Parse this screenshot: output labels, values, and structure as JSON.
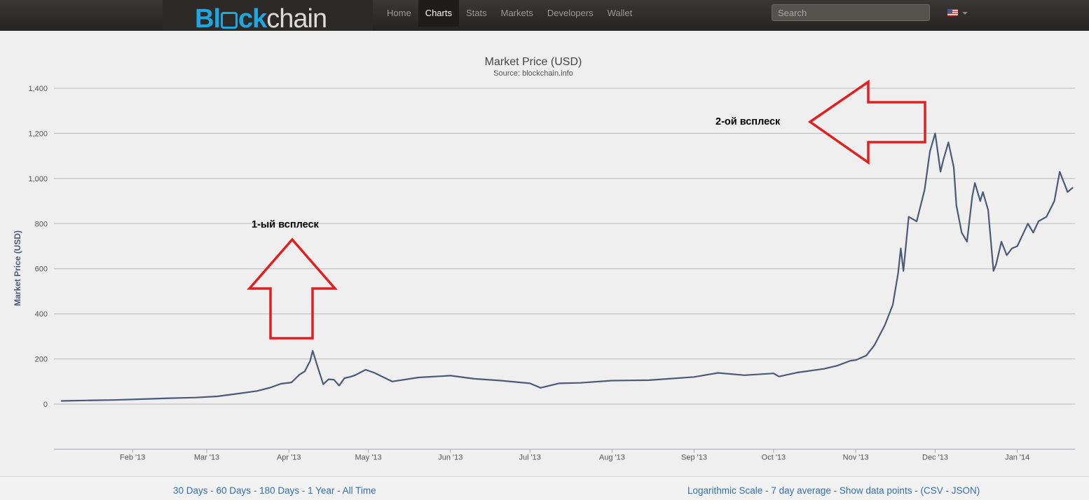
{
  "header": {
    "logo_part1": "Bl",
    "logo_part2": "ck",
    "logo_part3": "chain",
    "nav": [
      "Home",
      "Charts",
      "Stats",
      "Markets",
      "Developers",
      "Wallet"
    ],
    "active_nav": "Charts",
    "search_placeholder": "Search",
    "language_flag": "us-flag-icon"
  },
  "chart_data": {
    "type": "line",
    "title": "Market Price (USD)",
    "subtitle": "Source: blockchain.info",
    "ylabel": "Market Price (USD)",
    "xlabel": "",
    "ylim": [
      -200,
      1400
    ],
    "y_ticks": [
      0,
      200,
      400,
      600,
      800,
      1000,
      1200,
      1400
    ],
    "y_tick_labels": [
      "0",
      "200",
      "400",
      "600",
      "800",
      "1,000",
      "1,200",
      "1,400"
    ],
    "x_tick_labels": [
      "Feb '13",
      "Mar '13",
      "Apr '13",
      "May '13",
      "Jun '13",
      "Jul '13",
      "Aug '13",
      "Sep '13",
      "Oct '13",
      "Nov '13",
      "Dec '13",
      "Jan '14"
    ],
    "x_tick_dates": [
      "2013-02-01",
      "2013-03-01",
      "2013-04-01",
      "2013-05-01",
      "2013-06-01",
      "2013-07-01",
      "2013-08-01",
      "2013-09-01",
      "2013-10-01",
      "2013-11-01",
      "2013-12-01",
      "2014-01-01"
    ],
    "xlim": [
      "2013-01-01",
      "2014-01-24"
    ],
    "grid": true,
    "line_color": "#4a5a78",
    "series": [
      {
        "x": [
          "2013-01-05",
          "2013-01-15",
          "2013-01-25",
          "2013-02-05",
          "2013-02-15",
          "2013-02-25",
          "2013-03-05",
          "2013-03-12",
          "2013-03-20",
          "2013-03-25",
          "2013-03-29",
          "2013-04-02",
          "2013-04-05",
          "2013-04-07",
          "2013-04-09",
          "2013-04-10",
          "2013-04-12",
          "2013-04-14",
          "2013-04-16",
          "2013-04-18",
          "2013-04-20",
          "2013-04-22",
          "2013-04-24",
          "2013-04-26",
          "2013-04-30",
          "2013-05-03",
          "2013-05-10",
          "2013-05-20",
          "2013-06-01",
          "2013-06-10",
          "2013-06-20",
          "2013-07-01",
          "2013-07-05",
          "2013-07-12",
          "2013-07-20",
          "2013-08-01",
          "2013-08-15",
          "2013-09-01",
          "2013-09-10",
          "2013-09-20",
          "2013-10-01",
          "2013-10-03",
          "2013-10-10",
          "2013-10-20",
          "2013-10-25",
          "2013-10-30",
          "2013-11-01",
          "2013-11-05",
          "2013-11-08",
          "2013-11-12",
          "2013-11-15",
          "2013-11-17",
          "2013-11-18",
          "2013-11-19",
          "2013-11-21",
          "2013-11-24",
          "2013-11-27",
          "2013-11-29",
          "2013-12-01",
          "2013-12-03",
          "2013-12-04",
          "2013-12-06",
          "2013-12-08",
          "2013-12-09",
          "2013-12-11",
          "2013-12-13",
          "2013-12-15",
          "2013-12-16",
          "2013-12-18",
          "2013-12-19",
          "2013-12-21",
          "2013-12-23",
          "2013-12-24",
          "2013-12-26",
          "2013-12-28",
          "2013-12-30",
          "2014-01-01",
          "2014-01-05",
          "2014-01-07",
          "2014-01-09",
          "2014-01-12",
          "2014-01-15",
          "2014-01-17",
          "2014-01-20",
          "2014-01-22"
        ],
        "y": [
          14,
          16,
          18,
          22,
          26,
          29,
          34,
          45,
          58,
          73,
          90,
          96,
          130,
          145,
          190,
          236,
          160,
          88,
          110,
          108,
          82,
          115,
          120,
          128,
          152,
          140,
          100,
          118,
          126,
          112,
          104,
          92,
          72,
          92,
          94,
          104,
          106,
          120,
          138,
          128,
          136,
          122,
          140,
          156,
          170,
          192,
          195,
          215,
          260,
          350,
          440,
          580,
          690,
          590,
          830,
          810,
          950,
          1120,
          1200,
          1030,
          1080,
          1160,
          1050,
          880,
          760,
          720,
          920,
          980,
          900,
          940,
          860,
          590,
          620,
          720,
          660,
          690,
          700,
          800,
          760,
          810,
          830,
          900,
          1030,
          940,
          960
        ]
      }
    ],
    "annotations": [
      {
        "text": "1-ый всплеск",
        "arrow": "up"
      },
      {
        "text": "2-ой всплеск",
        "arrow": "left"
      }
    ]
  },
  "footer": {
    "ranges": [
      "30 Days",
      "60 Days",
      "180 Days",
      "1 Year",
      "All Time"
    ],
    "options": [
      "Logarithmic Scale",
      "7 day average",
      "Show data points"
    ],
    "export": [
      "CSV",
      "JSON"
    ]
  }
}
